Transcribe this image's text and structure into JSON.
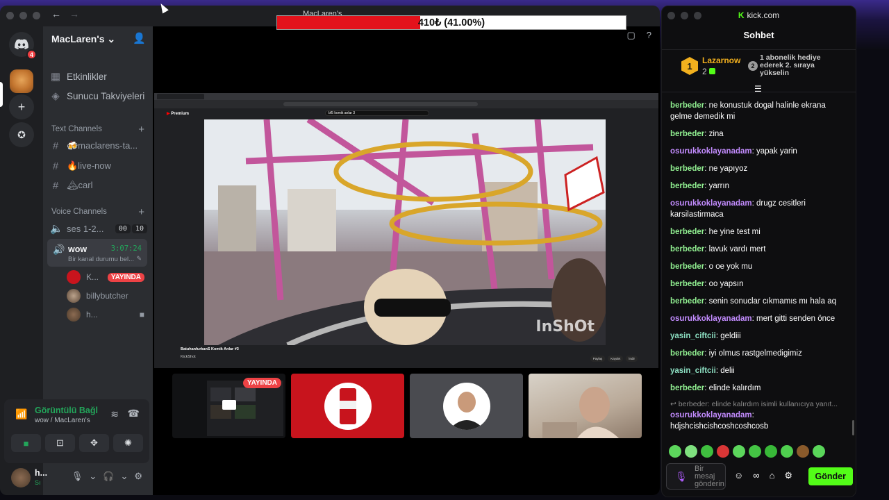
{
  "discord": {
    "nav_back": "←",
    "nav_forward": "→",
    "rail_badge": "4",
    "server_name": "MacLaren's",
    "server_chevron": "⌄",
    "menu": [
      {
        "label": "Etkinlikler",
        "icon": "calendar-icon"
      },
      {
        "label": "Sunucu Takviyeleri",
        "icon": "boost-icon"
      }
    ],
    "text_category": "Text Channels",
    "text_channels": [
      "🍻maclarens-ta...",
      "🔥live-now",
      "🏔carl"
    ],
    "voice_category": "Voice Channels",
    "voice_channel_1": {
      "name": "ses 1-2...",
      "count_left": "00",
      "count_right": "10"
    },
    "voice_active": {
      "name": "wow",
      "timer": "3:07:24",
      "status": "Bir kanal durumu bel..."
    },
    "voice_users": [
      {
        "name": "K...",
        "badge": "YAYINDA"
      },
      {
        "name": "billybutcher"
      },
      {
        "name": "h..."
      }
    ],
    "rtc": {
      "title": "Görüntülü Bağl",
      "subtitle": "wow / MacLaren's"
    },
    "user": {
      "name": "h...",
      "status": "Sı"
    },
    "stream_title": "MacLaren's",
    "tile_badge": "YAYINDA",
    "video": {
      "yt_logo": "Premium",
      "search_query": "bf5 komik anlar 3",
      "watermark": "InShOt",
      "video_title": "BatuhanfurkanS Komik Anlar #3",
      "channel": "KickShot",
      "actions": [
        "Paylaş",
        "Kaydet",
        "İndir"
      ]
    }
  },
  "donation": {
    "text": "410₺ (41.00%)",
    "progress": 0.41
  },
  "kick": {
    "site": "kick.com",
    "logo": "K",
    "title": "Sohbet",
    "top_gifter": {
      "rank": "1",
      "name": "Lazarnow",
      "count": "2"
    },
    "second_rank": "2",
    "gift_text": "1 abonelik hediye ederek 2. sıraya yükselin",
    "messages": [
      {
        "user": "berbeder",
        "text": "ne konustuk dogal halinle ekrana gelme demedik mi",
        "color": "green"
      },
      {
        "user": "berbeder",
        "text": "zina",
        "color": "green"
      },
      {
        "user": "osurukkoklayanadam",
        "text": "yapak yarin",
        "color": "purple"
      },
      {
        "user": "berbeder",
        "text": "ne yapıyoz",
        "color": "green"
      },
      {
        "user": "berbeder",
        "text": "yarrın",
        "color": "green"
      },
      {
        "user": "osurukkoklayanadam",
        "text": "drugz cesitleri karsilastirmaca",
        "color": "purple"
      },
      {
        "user": "berbeder",
        "text": "he yine test mi",
        "color": "green"
      },
      {
        "user": "berbeder",
        "text": "lavuk vardı mert",
        "color": "green"
      },
      {
        "user": "berbeder",
        "text": "o oe yok mu",
        "color": "green"
      },
      {
        "user": "berbeder",
        "text": "oo yapsın",
        "color": "green"
      },
      {
        "user": "berbeder",
        "text": "senin sonuclar cıkmamıs mı hala aq",
        "color": "green"
      },
      {
        "user": "osurukkoklayanadam",
        "text": "mert gitti senden önce",
        "color": "purple"
      },
      {
        "user": "yasin_ciftcii",
        "text": "geldiii",
        "color": "teal"
      },
      {
        "user": "berbeder",
        "text": "iyi olmus rastgelmedigimiz",
        "color": "green"
      },
      {
        "user": "yasin_ciftcii",
        "text": "delii",
        "color": "teal"
      },
      {
        "user": "berbeder",
        "text": "elinde kalırdım",
        "color": "green"
      }
    ],
    "reply_preview": "↩ berbeder: elinde kalırdım isimli kullanıcıya yanıt...",
    "last_message": {
      "user": "osurukkoklayanadam",
      "text": "hdjshcishcishcoshcoshcosb"
    },
    "input_placeholder": "Bir mesaj gönderin",
    "send_label": "Gönder"
  },
  "colors": {
    "discord_green": "#23a55a",
    "kick_green": "#53fc18",
    "live_red": "#ed4245",
    "progress_red": "#e3121b"
  }
}
